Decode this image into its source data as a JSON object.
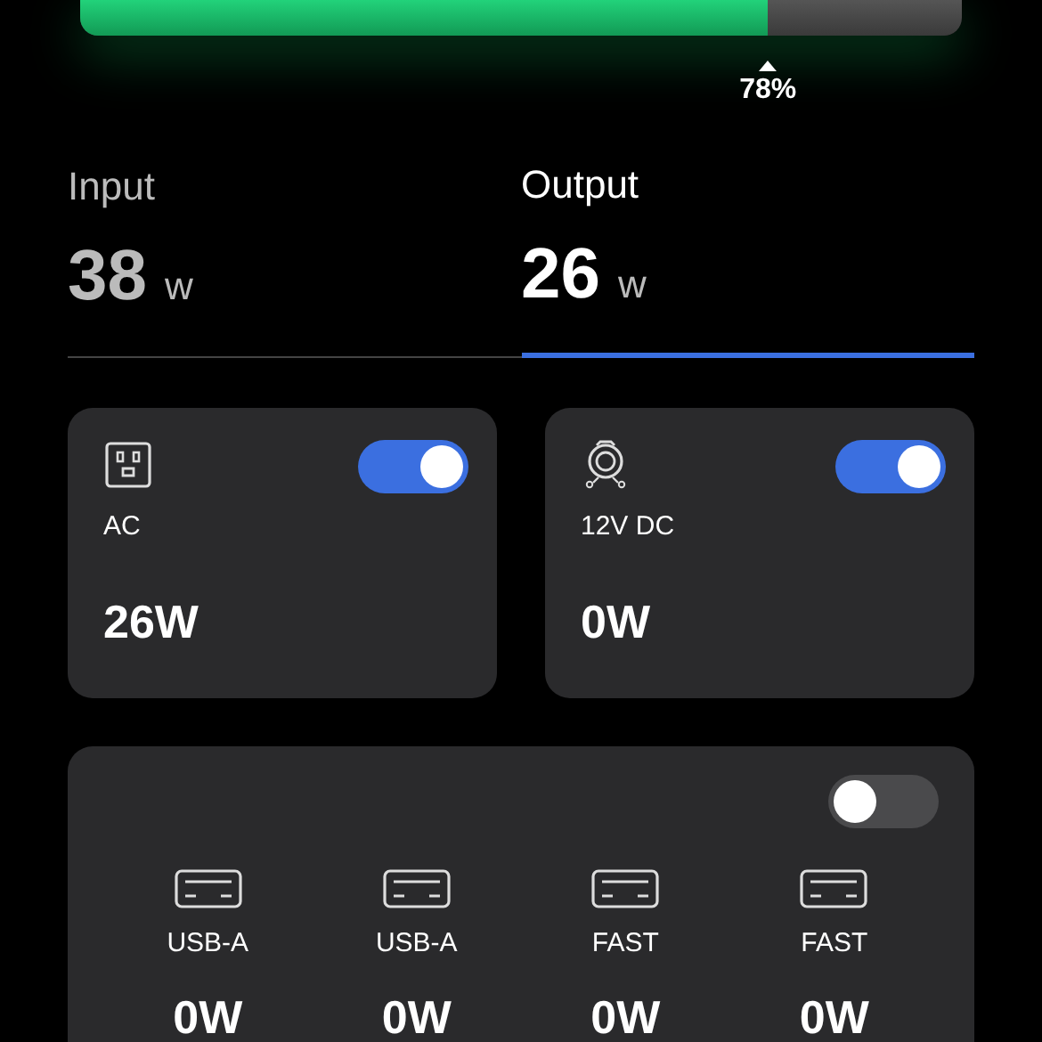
{
  "battery": {
    "level": 0.78,
    "reading": "78%"
  },
  "tabs": [
    {
      "label": "Input",
      "value": "38",
      "unit": "w",
      "selected": false
    },
    {
      "label": "Output",
      "value": "26",
      "unit": "w",
      "selected": true
    }
  ],
  "outputs": [
    {
      "kind": "ac",
      "label": "AC",
      "power": "26W",
      "on": true
    },
    {
      "kind": "dc",
      "label": "12V DC",
      "power": "0W",
      "on": true
    }
  ],
  "usb_group": {
    "on": false,
    "ports": [
      {
        "label": "USB-A",
        "power": "0W"
      },
      {
        "label": "USB-A",
        "power": "0W"
      },
      {
        "label": "FAST",
        "power": "0W"
      },
      {
        "label": "FAST",
        "power": "0W"
      }
    ]
  }
}
